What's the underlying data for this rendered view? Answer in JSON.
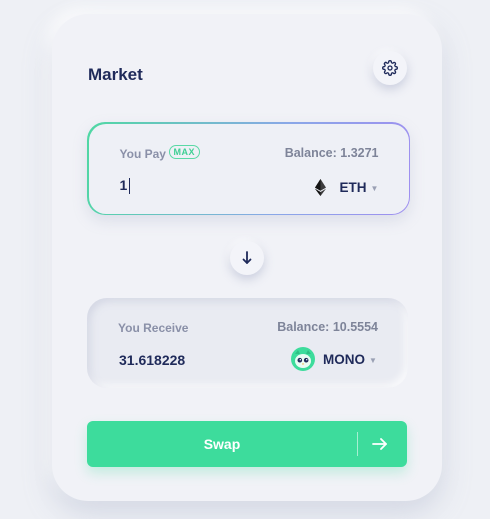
{
  "market": {
    "title": "Market"
  },
  "pay": {
    "label": "You Pay",
    "max_label": "MAX",
    "balance": "Balance: 1.3271",
    "amount": "1",
    "token": "ETH",
    "token_icon": "ethereum-icon"
  },
  "receive": {
    "label": "You Receive",
    "balance": "Balance: 10.5554",
    "amount": "31.618228",
    "token": "MONO",
    "token_icon": "mono-owl-icon"
  },
  "actions": {
    "swap_label": "Swap"
  },
  "colors": {
    "accent": "#3ddc9c",
    "text_dark": "#1f2a5a",
    "text_muted": "#8a90a8"
  }
}
